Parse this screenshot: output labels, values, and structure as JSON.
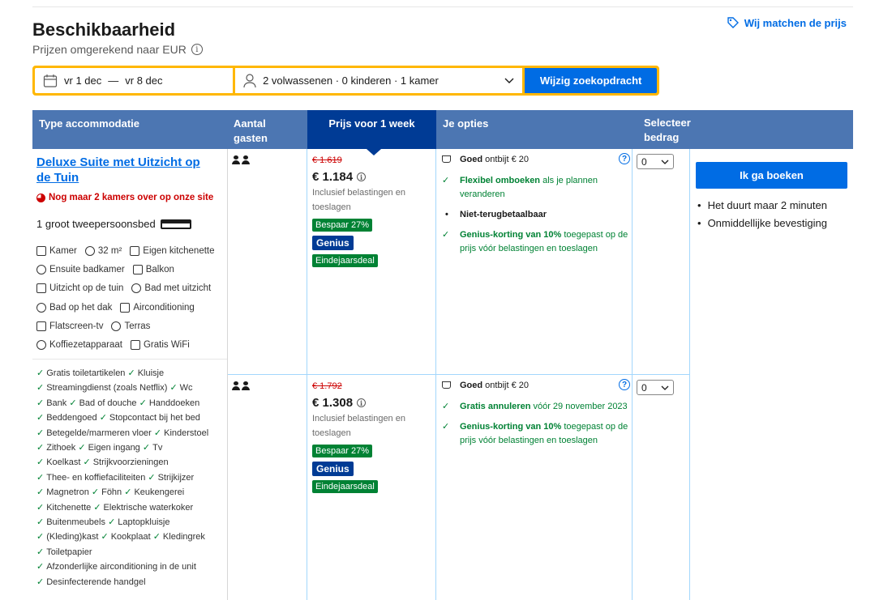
{
  "header": {
    "title": "Beschikbaarheid",
    "subtitle": "Prijzen omgerekend naar EUR",
    "price_match": "Wij matchen de prijs"
  },
  "search": {
    "date_from": "vr 1 dec",
    "date_sep": "—",
    "date_to": "vr 8 dec",
    "guests": "2 volwassenen · 0 kinderen · 1 kamer",
    "button": "Wijzig zoekopdracht"
  },
  "table_headers": {
    "type": "Type accommodatie",
    "guests": "Aantal gasten",
    "price": "Prijs voor 1 week",
    "options": "Je opties",
    "select": "Selecteer bedrag"
  },
  "room": {
    "name": "Deluxe Suite met Uitzicht op de Tuin",
    "scarcity": "Nog maar 2 kamers over op onze site",
    "bed": "1 groot tweepersoonsbed",
    "facilities": [
      [
        "Kamer",
        "32 m²",
        "Eigen kitchenette"
      ],
      [
        "Ensuite badkamer",
        "Balkon"
      ],
      [
        "Uitzicht op de tuin",
        "Bad met uitzicht"
      ],
      [
        "Bad op het dak",
        "Airconditioning"
      ],
      [
        "Flatscreen-tv",
        "Terras"
      ],
      [
        "Koffiezetapparaat",
        "Gratis WiFi"
      ]
    ],
    "amenities": [
      [
        "Gratis toiletartikelen",
        "Kluisje"
      ],
      [
        "Streamingdienst (zoals Netflix)",
        "Wc"
      ],
      [
        "Bank",
        "Bad of douche",
        "Handdoeken"
      ],
      [
        "Beddengoed",
        "Stopcontact bij het bed"
      ],
      [
        "Betegelde/marmeren vloer",
        "Kinderstoel"
      ],
      [
        "Zithoek",
        "Eigen ingang",
        "Tv"
      ],
      [
        "Koelkast",
        "Strijkvoorzieningen"
      ],
      [
        "Thee- en koffiefaciliteiten",
        "Strijkijzer"
      ],
      [
        "Magnetron",
        "Föhn",
        "Keukengerei"
      ],
      [
        "Kitchenette",
        "Elektrische waterkoker"
      ],
      [
        "Buitenmeubels",
        "Laptopkluisje"
      ],
      [
        "(Kleding)kast",
        "Kookplaat",
        "Kledingrek"
      ],
      [
        "Toiletpapier"
      ],
      [
        "Afzonderlijke airconditioning in de unit"
      ],
      [
        "Desinfecterende handgel"
      ]
    ]
  },
  "offers": [
    {
      "old_price": "€ 1.619",
      "price": "€ 1.184",
      "note": "Inclusief belastingen en toeslagen",
      "badge_save": "Bespaar 27%",
      "badge_genius": "Genius",
      "badge_deal": "Eindejaarsdeal",
      "meal_bold": "Goed",
      "meal_rest": " ontbijt € 20",
      "opt2_bold": "Flexibel omboeken",
      "opt2_rest": " als je plannen veranderen",
      "opt3_bold": "Niet-terugbetaalbaar",
      "opt4_bold": "Genius-korting van 10%",
      "opt4_rest": " toegepast op de prijs vóór belastingen en toeslagen",
      "select_value": "0"
    },
    {
      "old_price": "€ 1.792",
      "price": "€ 1.308",
      "note": "Inclusief belastingen en toeslagen",
      "badge_save": "Bespaar 27%",
      "badge_genius": "Genius",
      "badge_deal": "Eindejaarsdeal",
      "meal_bold": "Goed",
      "meal_rest": " ontbijt € 20",
      "opt2_bold": "Gratis annuleren",
      "opt2_rest": " vóór 29 november 2023",
      "opt4_bold": "Genius-korting van 10%",
      "opt4_rest": " toegepast op de prijs vóór belastingen en toeslagen",
      "select_value": "0"
    }
  ],
  "booking": {
    "button": "Ik ga boeken",
    "bullets": [
      "Het duurt maar 2 minuten",
      "Onmiddellijke bevestiging"
    ]
  },
  "colors": {
    "primary": "#006ce4",
    "header_bg": "#4c76b2",
    "header_selected": "#003b95",
    "green": "#008234",
    "alert": "#cc0000",
    "search_border": "#ffb700"
  }
}
